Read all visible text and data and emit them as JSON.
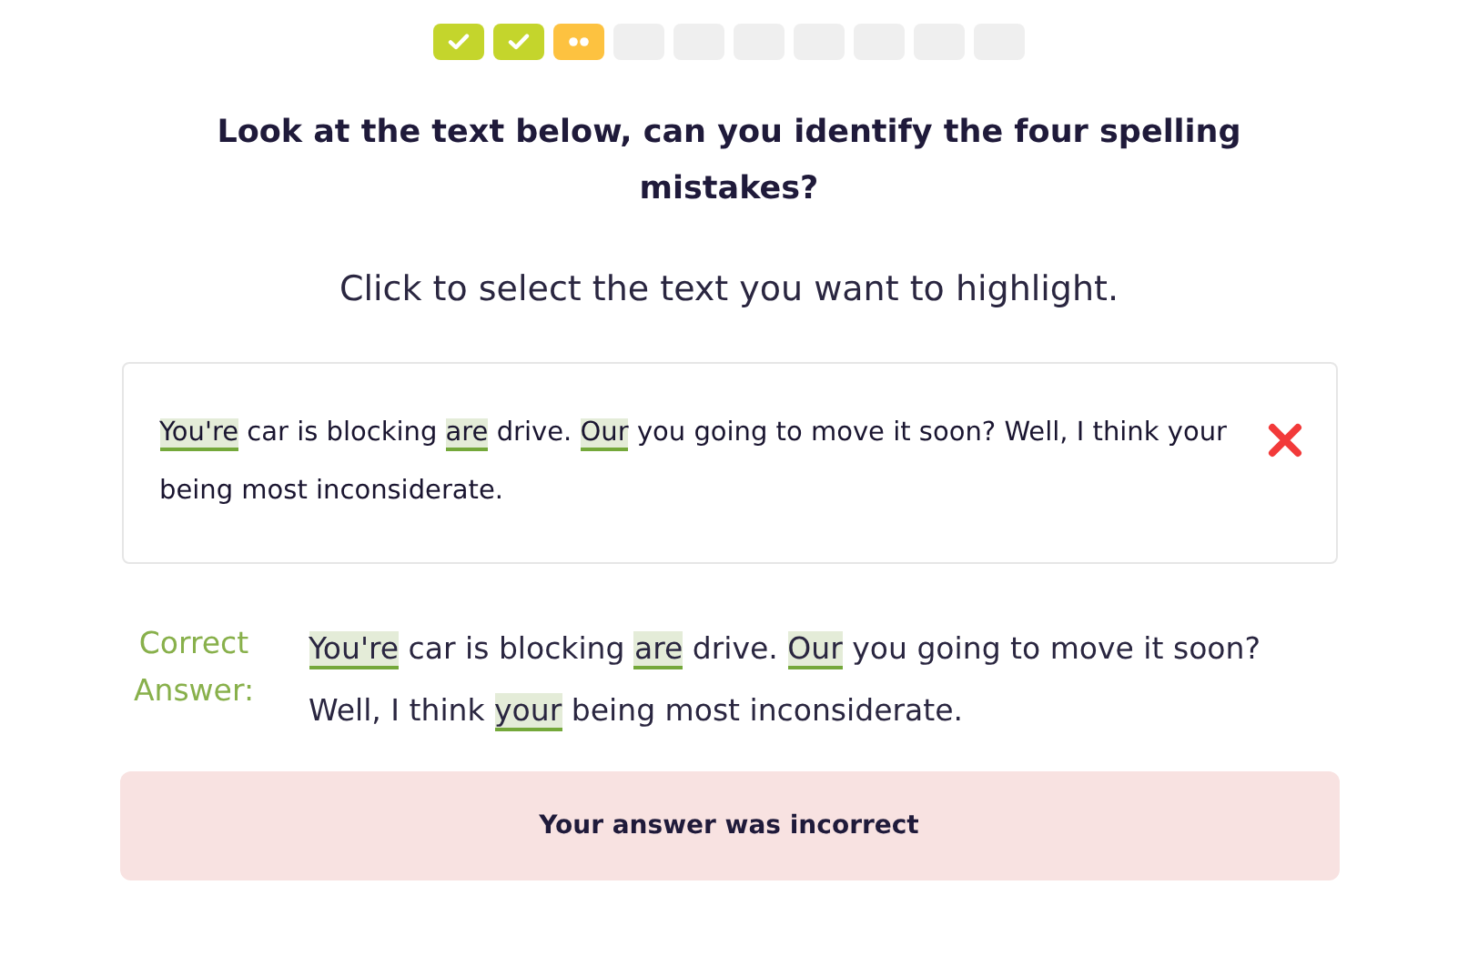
{
  "progress": [
    {
      "kind": "correct"
    },
    {
      "kind": "correct"
    },
    {
      "kind": "current"
    },
    {
      "kind": "pending"
    },
    {
      "kind": "pending"
    },
    {
      "kind": "pending"
    },
    {
      "kind": "pending"
    },
    {
      "kind": "pending"
    },
    {
      "kind": "pending"
    },
    {
      "kind": "pending"
    }
  ],
  "question": "Look at the text below, can you identify the four spelling mistakes?",
  "instruction": "Click to select the text you want to highlight.",
  "answer": {
    "segments": [
      {
        "text": "You're",
        "highlighted": true
      },
      {
        "text": " car is blocking ",
        "highlighted": false
      },
      {
        "text": "are",
        "highlighted": true
      },
      {
        "text": " drive. ",
        "highlighted": false
      },
      {
        "text": "Our",
        "highlighted": true
      },
      {
        "text": " you going to move it soon? Well, I think your being most inconsiderate.",
        "highlighted": false
      }
    ],
    "correct": false
  },
  "correct_answer": {
    "label": "Correct Answer:",
    "segments": [
      {
        "text": "You're",
        "highlighted": true
      },
      {
        "text": " car is blocking ",
        "highlighted": false
      },
      {
        "text": "are",
        "highlighted": true
      },
      {
        "text": " drive. ",
        "highlighted": false
      },
      {
        "text": "Our",
        "highlighted": true
      },
      {
        "text": " you going to move it soon? Well, I think ",
        "highlighted": false
      },
      {
        "text": "your",
        "highlighted": true
      },
      {
        "text": " being most inconsiderate.",
        "highlighted": false
      }
    ]
  },
  "feedback": "Your answer was incorrect"
}
